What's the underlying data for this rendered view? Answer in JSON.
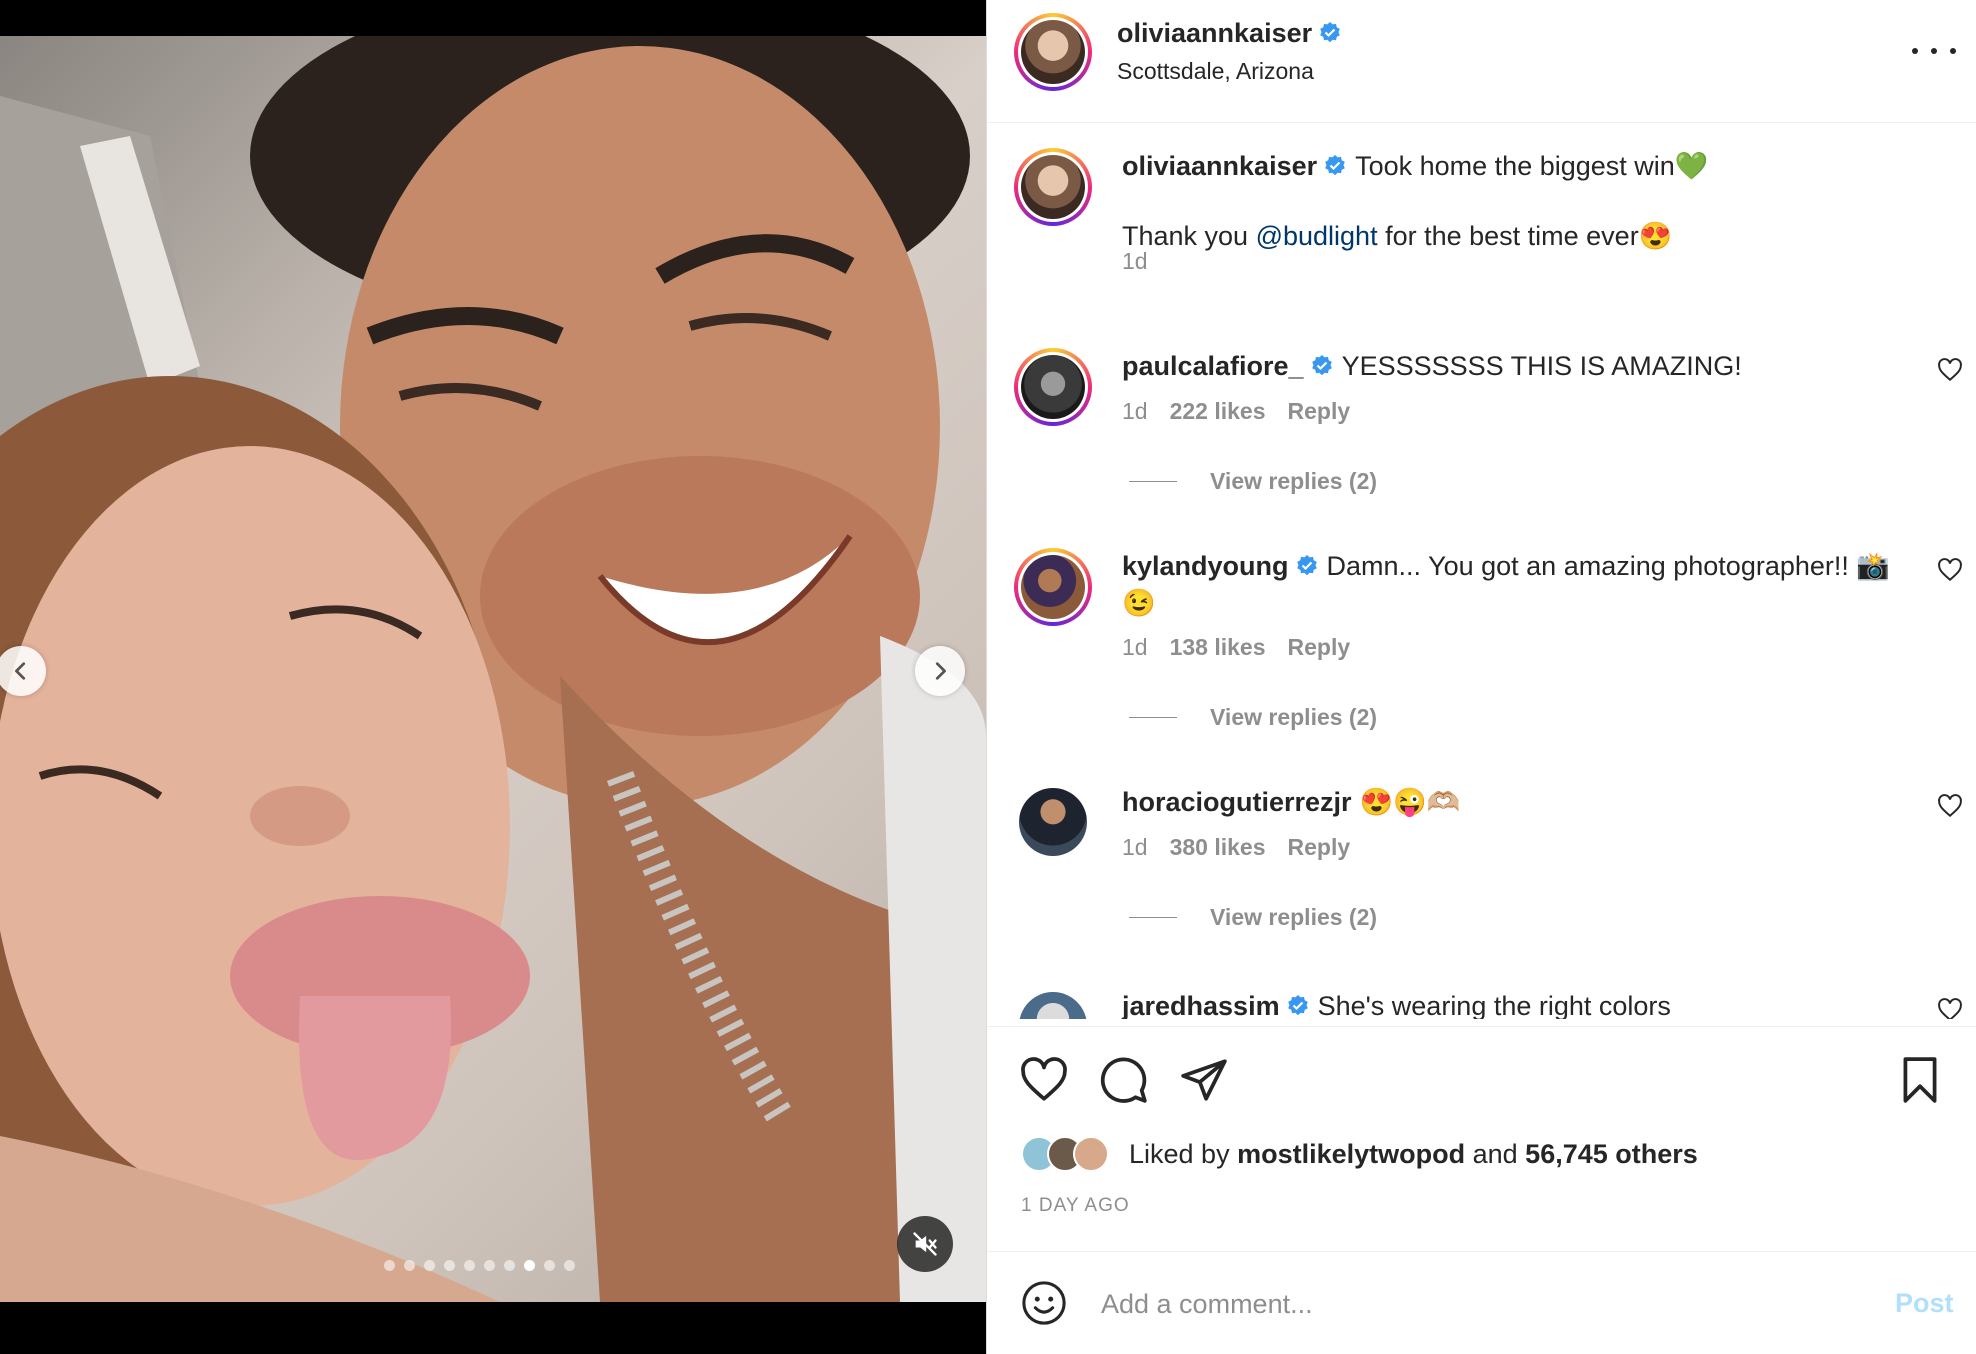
{
  "post": {
    "author": "oliviaannkaiser",
    "location": "Scottsdale, Arizona",
    "caption_line1": "Took home the biggest win💚",
    "caption_line2_pre": "Thank you ",
    "caption_mention": "@budlight",
    "caption_line2_post": " for the best time ever😍",
    "caption_time": "1d"
  },
  "media": {
    "carousel_total": 10,
    "carousel_active": 8,
    "muted": true
  },
  "comments": [
    {
      "user": "paulcalafiore_",
      "verified": true,
      "text": "YESSSSSSS THIS IS AMAZING!",
      "time": "1d",
      "likes": "222 likes",
      "reply": "Reply",
      "view_replies": "View replies (2)"
    },
    {
      "user": "kylandyoung",
      "verified": true,
      "text": "Damn... You got an amazing photographer!! 📸😉",
      "time": "1d",
      "likes": "138 likes",
      "reply": "Reply",
      "view_replies": "View replies (2)"
    },
    {
      "user": "horaciogutierrezjr",
      "verified": false,
      "text": "😍😜🫶🏼",
      "time": "1d",
      "likes": "380 likes",
      "reply": "Reply",
      "view_replies": "View replies (2)"
    },
    {
      "user": "jaredhassim",
      "verified": true,
      "text": "She's wearing the right colors"
    }
  ],
  "engagement": {
    "liked_by_prefix": "Liked by ",
    "liked_by_user": "mostlikelytwopod",
    "liked_by_and": " and ",
    "liked_by_count": "56,745 others",
    "time_ago": "1 DAY AGO"
  },
  "comment_box": {
    "placeholder": "Add a comment...",
    "post_label": "Post"
  },
  "colors": {
    "verified_blue": "#3897f0",
    "post_button_disabled": "#b2dffc",
    "mention": "#00376b"
  }
}
